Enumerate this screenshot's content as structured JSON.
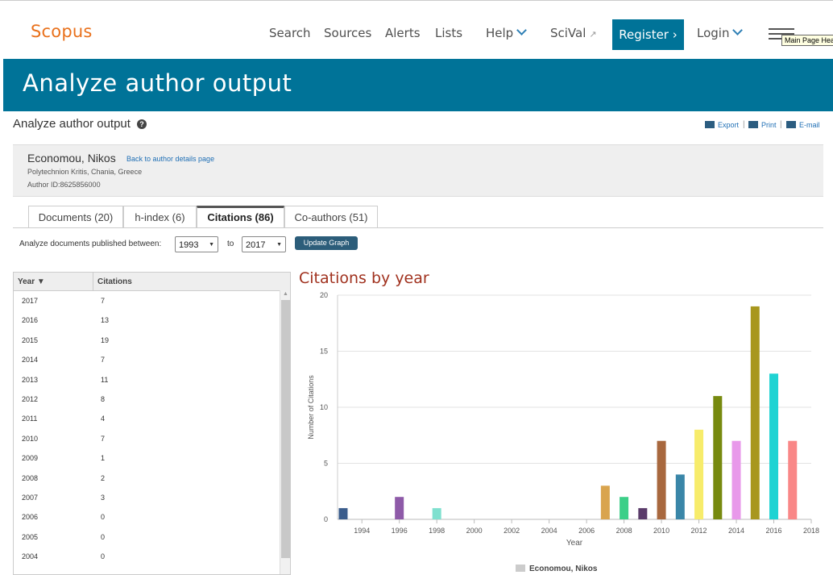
{
  "header": {
    "logo": "Scopus",
    "nav": {
      "search": "Search",
      "sources": "Sources",
      "alerts": "Alerts",
      "lists": "Lists",
      "help": "Help",
      "scival": "SciVal",
      "scival_ext": "↗",
      "register": "Register",
      "register_arrow": "›",
      "login": "Login"
    },
    "tooltip": "Main Page Head"
  },
  "page": {
    "title": "Analyze author output",
    "subtitle": "Analyze author output",
    "help_glyph": "?"
  },
  "tools": {
    "export": "Export",
    "print": "Print",
    "email": "E-mail"
  },
  "author": {
    "name": "Economou, Nikos",
    "back_link": "Back to author details page",
    "affiliation": "Polytechnion Kritis, Chania, Greece",
    "author_id": "Author ID:8625856000"
  },
  "tabs": [
    {
      "label": "Documents (20)"
    },
    {
      "label": "h-index (6)"
    },
    {
      "label": "Citations (86)"
    },
    {
      "label": "Co-authors (51)"
    }
  ],
  "filter": {
    "label": "Analyze documents published between:",
    "from": "1993",
    "to_label": "to",
    "to": "2017",
    "button": "Update Graph"
  },
  "table": {
    "col_year": "Year ▼",
    "col_citations": "Citations",
    "rows": [
      {
        "year": "2017",
        "citations": "7"
      },
      {
        "year": "2016",
        "citations": "13"
      },
      {
        "year": "2015",
        "citations": "19"
      },
      {
        "year": "2014",
        "citations": "7"
      },
      {
        "year": "2013",
        "citations": "11"
      },
      {
        "year": "2012",
        "citations": "8"
      },
      {
        "year": "2011",
        "citations": "4"
      },
      {
        "year": "2010",
        "citations": "7"
      },
      {
        "year": "2009",
        "citations": "1"
      },
      {
        "year": "2008",
        "citations": "2"
      },
      {
        "year": "2007",
        "citations": "3"
      },
      {
        "year": "2006",
        "citations": "0"
      },
      {
        "year": "2005",
        "citations": "0"
      },
      {
        "year": "2004",
        "citations": "0"
      }
    ]
  },
  "chart_data": {
    "type": "bar",
    "title": "Citations by year",
    "xlabel": "Year",
    "ylabel": "Number of Citations",
    "ylim": [
      0,
      20
    ],
    "yticks": [
      0,
      5,
      10,
      15,
      20
    ],
    "xlim": [
      1992.7,
      2018
    ],
    "xticks": [
      1994,
      1996,
      1998,
      2000,
      2002,
      2004,
      2006,
      2008,
      2010,
      2012,
      2014,
      2016,
      2018
    ],
    "grid": "horizontal",
    "legend": "bottom-center",
    "series": [
      {
        "name": "Economou, Nikos",
        "values": [
          {
            "x": 1993,
            "y": 1,
            "color": "#3b5d8c"
          },
          {
            "x": 1996,
            "y": 2,
            "color": "#8e5aa8"
          },
          {
            "x": 1998,
            "y": 1,
            "color": "#7fe0cf"
          },
          {
            "x": 2007,
            "y": 3,
            "color": "#d9a44e"
          },
          {
            "x": 2008,
            "y": 2,
            "color": "#3ccf88"
          },
          {
            "x": 2009,
            "y": 1,
            "color": "#5a3b6a"
          },
          {
            "x": 2010,
            "y": 7,
            "color": "#a8683e"
          },
          {
            "x": 2011,
            "y": 4,
            "color": "#3a86a8"
          },
          {
            "x": 2012,
            "y": 8,
            "color": "#f7ec6b"
          },
          {
            "x": 2013,
            "y": 11,
            "color": "#778a0f"
          },
          {
            "x": 2014,
            "y": 7,
            "color": "#e899ea"
          },
          {
            "x": 2015,
            "y": 19,
            "color": "#a8971e"
          },
          {
            "x": 2016,
            "y": 13,
            "color": "#1fd3d3"
          },
          {
            "x": 2017,
            "y": 7,
            "color": "#f98787"
          }
        ]
      }
    ]
  }
}
